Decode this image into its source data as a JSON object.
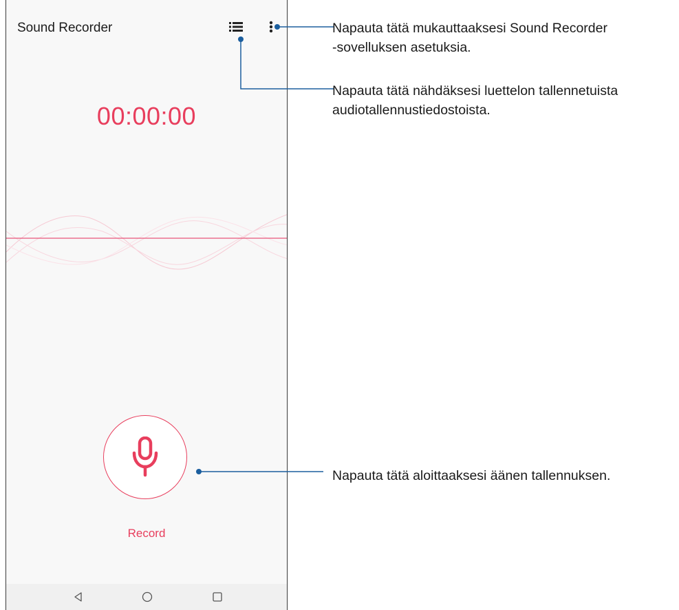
{
  "app": {
    "title": "Sound Recorder",
    "timer": "00:00:00",
    "record_label": "Record",
    "accent_color": "#e83e5d"
  },
  "toolbar": {
    "list_icon": "list-icon",
    "more_icon": "more-vert-icon"
  },
  "record_button": {
    "icon": "microphone-icon"
  },
  "navigation": {
    "back_icon": "back-triangle-icon",
    "home_icon": "home-circle-icon",
    "recents_icon": "recents-square-icon"
  },
  "callouts": {
    "settings_line1": "Napauta tätä mukauttaaksesi Sound Recorder",
    "settings_line2": "-sovelluksen asetuksia.",
    "list_line1": "Napauta tätä nähdäksesi luettelon tallennetuista",
    "list_line2": "audiotallennustiedostoista.",
    "record": "Napauta tätä aloittaaksesi äänen tallennuksen."
  },
  "callout_color": "#1b5e9e"
}
